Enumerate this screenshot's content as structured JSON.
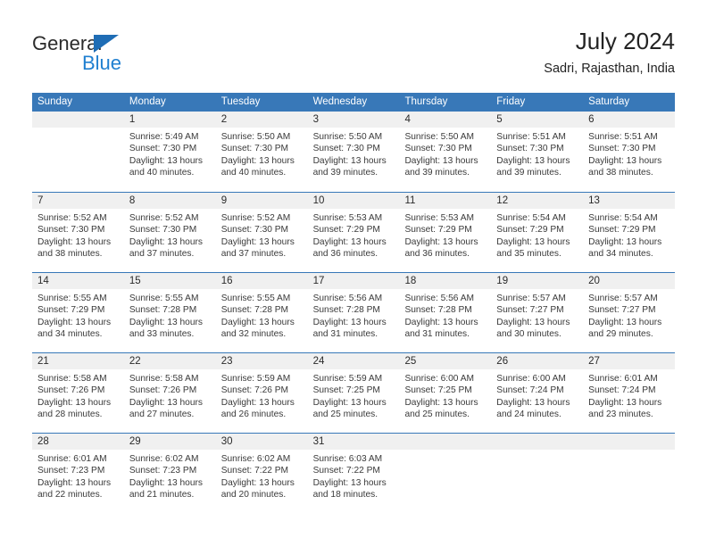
{
  "brand": {
    "name_top": "General",
    "name_bottom": "Blue",
    "accent_color": "#1f7fd0",
    "triangle_color": "#1f6db5"
  },
  "header": {
    "title": "July 2024",
    "subtitle": "Sadri, Rajasthan, India"
  },
  "theme": {
    "header_blue": "#3878b8",
    "daynum_band": "#f0f0f0",
    "text_color": "#3a3a3a"
  },
  "weekdays": [
    "Sunday",
    "Monday",
    "Tuesday",
    "Wednesday",
    "Thursday",
    "Friday",
    "Saturday"
  ],
  "weeks": [
    [
      {
        "day": "",
        "sunrise": "",
        "sunset": "",
        "daylight_line1": "",
        "daylight_line2": ""
      },
      {
        "day": "1",
        "sunrise": "Sunrise: 5:49 AM",
        "sunset": "Sunset: 7:30 PM",
        "daylight_line1": "Daylight: 13 hours",
        "daylight_line2": "and 40 minutes."
      },
      {
        "day": "2",
        "sunrise": "Sunrise: 5:50 AM",
        "sunset": "Sunset: 7:30 PM",
        "daylight_line1": "Daylight: 13 hours",
        "daylight_line2": "and 40 minutes."
      },
      {
        "day": "3",
        "sunrise": "Sunrise: 5:50 AM",
        "sunset": "Sunset: 7:30 PM",
        "daylight_line1": "Daylight: 13 hours",
        "daylight_line2": "and 39 minutes."
      },
      {
        "day": "4",
        "sunrise": "Sunrise: 5:50 AM",
        "sunset": "Sunset: 7:30 PM",
        "daylight_line1": "Daylight: 13 hours",
        "daylight_line2": "and 39 minutes."
      },
      {
        "day": "5",
        "sunrise": "Sunrise: 5:51 AM",
        "sunset": "Sunset: 7:30 PM",
        "daylight_line1": "Daylight: 13 hours",
        "daylight_line2": "and 39 minutes."
      },
      {
        "day": "6",
        "sunrise": "Sunrise: 5:51 AM",
        "sunset": "Sunset: 7:30 PM",
        "daylight_line1": "Daylight: 13 hours",
        "daylight_line2": "and 38 minutes."
      }
    ],
    [
      {
        "day": "7",
        "sunrise": "Sunrise: 5:52 AM",
        "sunset": "Sunset: 7:30 PM",
        "daylight_line1": "Daylight: 13 hours",
        "daylight_line2": "and 38 minutes."
      },
      {
        "day": "8",
        "sunrise": "Sunrise: 5:52 AM",
        "sunset": "Sunset: 7:30 PM",
        "daylight_line1": "Daylight: 13 hours",
        "daylight_line2": "and 37 minutes."
      },
      {
        "day": "9",
        "sunrise": "Sunrise: 5:52 AM",
        "sunset": "Sunset: 7:30 PM",
        "daylight_line1": "Daylight: 13 hours",
        "daylight_line2": "and 37 minutes."
      },
      {
        "day": "10",
        "sunrise": "Sunrise: 5:53 AM",
        "sunset": "Sunset: 7:29 PM",
        "daylight_line1": "Daylight: 13 hours",
        "daylight_line2": "and 36 minutes."
      },
      {
        "day": "11",
        "sunrise": "Sunrise: 5:53 AM",
        "sunset": "Sunset: 7:29 PM",
        "daylight_line1": "Daylight: 13 hours",
        "daylight_line2": "and 36 minutes."
      },
      {
        "day": "12",
        "sunrise": "Sunrise: 5:54 AM",
        "sunset": "Sunset: 7:29 PM",
        "daylight_line1": "Daylight: 13 hours",
        "daylight_line2": "and 35 minutes."
      },
      {
        "day": "13",
        "sunrise": "Sunrise: 5:54 AM",
        "sunset": "Sunset: 7:29 PM",
        "daylight_line1": "Daylight: 13 hours",
        "daylight_line2": "and 34 minutes."
      }
    ],
    [
      {
        "day": "14",
        "sunrise": "Sunrise: 5:55 AM",
        "sunset": "Sunset: 7:29 PM",
        "daylight_line1": "Daylight: 13 hours",
        "daylight_line2": "and 34 minutes."
      },
      {
        "day": "15",
        "sunrise": "Sunrise: 5:55 AM",
        "sunset": "Sunset: 7:28 PM",
        "daylight_line1": "Daylight: 13 hours",
        "daylight_line2": "and 33 minutes."
      },
      {
        "day": "16",
        "sunrise": "Sunrise: 5:55 AM",
        "sunset": "Sunset: 7:28 PM",
        "daylight_line1": "Daylight: 13 hours",
        "daylight_line2": "and 32 minutes."
      },
      {
        "day": "17",
        "sunrise": "Sunrise: 5:56 AM",
        "sunset": "Sunset: 7:28 PM",
        "daylight_line1": "Daylight: 13 hours",
        "daylight_line2": "and 31 minutes."
      },
      {
        "day": "18",
        "sunrise": "Sunrise: 5:56 AM",
        "sunset": "Sunset: 7:28 PM",
        "daylight_line1": "Daylight: 13 hours",
        "daylight_line2": "and 31 minutes."
      },
      {
        "day": "19",
        "sunrise": "Sunrise: 5:57 AM",
        "sunset": "Sunset: 7:27 PM",
        "daylight_line1": "Daylight: 13 hours",
        "daylight_line2": "and 30 minutes."
      },
      {
        "day": "20",
        "sunrise": "Sunrise: 5:57 AM",
        "sunset": "Sunset: 7:27 PM",
        "daylight_line1": "Daylight: 13 hours",
        "daylight_line2": "and 29 minutes."
      }
    ],
    [
      {
        "day": "21",
        "sunrise": "Sunrise: 5:58 AM",
        "sunset": "Sunset: 7:26 PM",
        "daylight_line1": "Daylight: 13 hours",
        "daylight_line2": "and 28 minutes."
      },
      {
        "day": "22",
        "sunrise": "Sunrise: 5:58 AM",
        "sunset": "Sunset: 7:26 PM",
        "daylight_line1": "Daylight: 13 hours",
        "daylight_line2": "and 27 minutes."
      },
      {
        "day": "23",
        "sunrise": "Sunrise: 5:59 AM",
        "sunset": "Sunset: 7:26 PM",
        "daylight_line1": "Daylight: 13 hours",
        "daylight_line2": "and 26 minutes."
      },
      {
        "day": "24",
        "sunrise": "Sunrise: 5:59 AM",
        "sunset": "Sunset: 7:25 PM",
        "daylight_line1": "Daylight: 13 hours",
        "daylight_line2": "and 25 minutes."
      },
      {
        "day": "25",
        "sunrise": "Sunrise: 6:00 AM",
        "sunset": "Sunset: 7:25 PM",
        "daylight_line1": "Daylight: 13 hours",
        "daylight_line2": "and 25 minutes."
      },
      {
        "day": "26",
        "sunrise": "Sunrise: 6:00 AM",
        "sunset": "Sunset: 7:24 PM",
        "daylight_line1": "Daylight: 13 hours",
        "daylight_line2": "and 24 minutes."
      },
      {
        "day": "27",
        "sunrise": "Sunrise: 6:01 AM",
        "sunset": "Sunset: 7:24 PM",
        "daylight_line1": "Daylight: 13 hours",
        "daylight_line2": "and 23 minutes."
      }
    ],
    [
      {
        "day": "28",
        "sunrise": "Sunrise: 6:01 AM",
        "sunset": "Sunset: 7:23 PM",
        "daylight_line1": "Daylight: 13 hours",
        "daylight_line2": "and 22 minutes."
      },
      {
        "day": "29",
        "sunrise": "Sunrise: 6:02 AM",
        "sunset": "Sunset: 7:23 PM",
        "daylight_line1": "Daylight: 13 hours",
        "daylight_line2": "and 21 minutes."
      },
      {
        "day": "30",
        "sunrise": "Sunrise: 6:02 AM",
        "sunset": "Sunset: 7:22 PM",
        "daylight_line1": "Daylight: 13 hours",
        "daylight_line2": "and 20 minutes."
      },
      {
        "day": "31",
        "sunrise": "Sunrise: 6:03 AM",
        "sunset": "Sunset: 7:22 PM",
        "daylight_line1": "Daylight: 13 hours",
        "daylight_line2": "and 18 minutes."
      },
      {
        "day": "",
        "sunrise": "",
        "sunset": "",
        "daylight_line1": "",
        "daylight_line2": ""
      },
      {
        "day": "",
        "sunrise": "",
        "sunset": "",
        "daylight_line1": "",
        "daylight_line2": ""
      },
      {
        "day": "",
        "sunrise": "",
        "sunset": "",
        "daylight_line1": "",
        "daylight_line2": ""
      }
    ]
  ]
}
